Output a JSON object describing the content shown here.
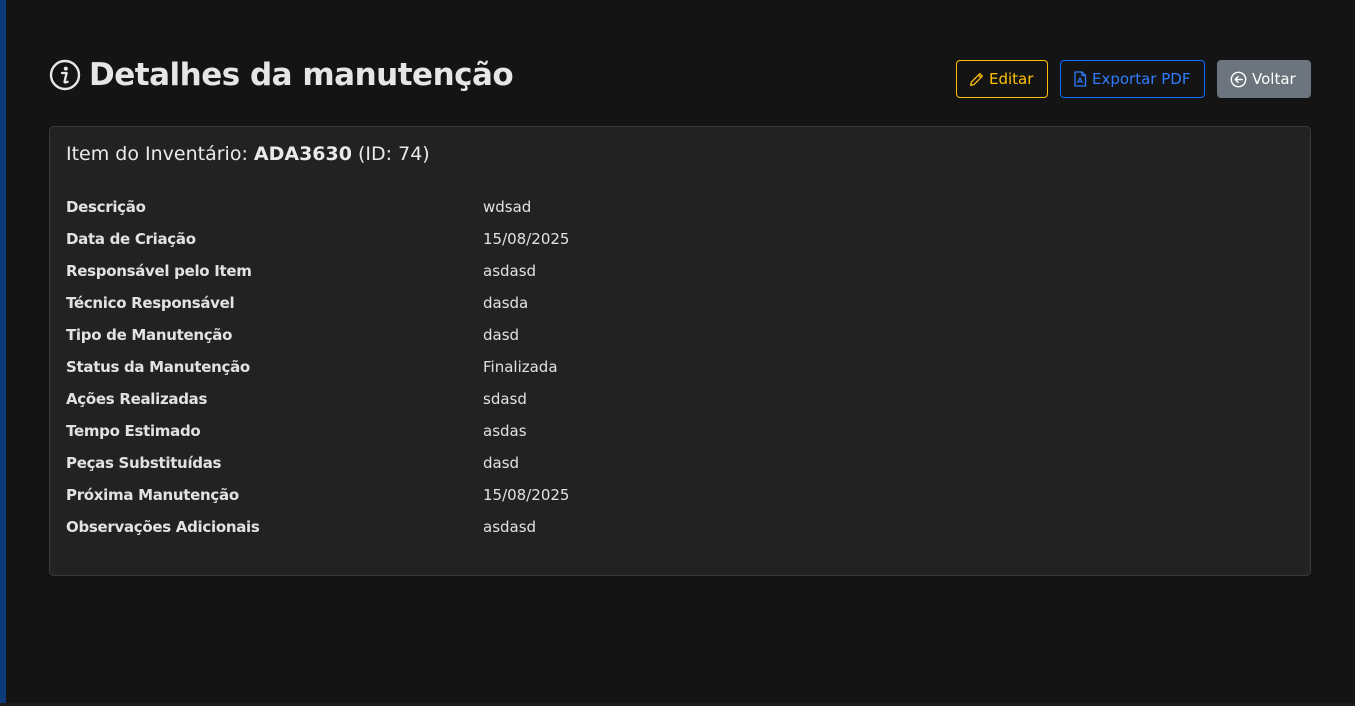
{
  "page": {
    "title": "Detalhes da manutenção",
    "title_icon": "info-circle-icon"
  },
  "actions": {
    "edit_label": "Editar",
    "edit_icon": "pencil-icon",
    "export_label": "Exportar PDF",
    "export_icon": "file-pdf-icon",
    "back_label": "Voltar",
    "back_icon": "arrow-left-circle-icon"
  },
  "card": {
    "title_prefix": "Item do Inventário:",
    "item_code": "ADA3630",
    "item_id": "(ID: 74)"
  },
  "details": [
    {
      "label": "Descrição",
      "value": "wdsad"
    },
    {
      "label": "Data de Criação",
      "value": "15/08/2025"
    },
    {
      "label": "Responsável pelo Item",
      "value": "asdasd"
    },
    {
      "label": "Técnico Responsável",
      "value": "dasda"
    },
    {
      "label": "Tipo de Manutenção",
      "value": "dasd"
    },
    {
      "label": "Status da Manutenção",
      "value": "Finalizada"
    },
    {
      "label": "Ações Realizadas",
      "value": "sdasd"
    },
    {
      "label": "Tempo Estimado",
      "value": "asdas"
    },
    {
      "label": "Peças Substituídas",
      "value": "dasd"
    },
    {
      "label": "Próxima Manutenção",
      "value": "15/08/2025"
    },
    {
      "label": "Observações Adicionais",
      "value": "asdasd"
    }
  ],
  "colors": {
    "background": "#141414",
    "card": "#222222",
    "warning": "#ffc107",
    "primary": "#0d6efd",
    "secondary": "#6c757d"
  }
}
